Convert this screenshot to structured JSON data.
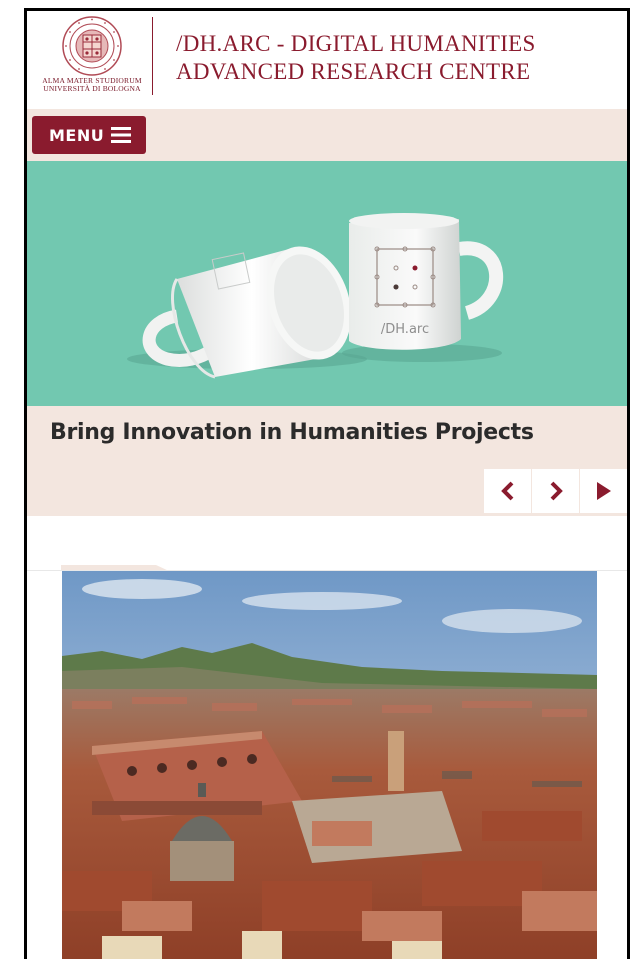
{
  "header": {
    "logo_lines": [
      "ALMA MATER STUDIORUM",
      "UNIVERSITÀ DI BOLOGNA"
    ],
    "title_line1": "/DH.ARC - DIGITAL HUMANITIES",
    "title_line2": "ADVANCED RESEARCH CENTRE"
  },
  "menu": {
    "label": "MENU",
    "icon": "hamburger-icon"
  },
  "slider": {
    "mug_label": "/DH.arc",
    "caption": "Bring Innovation in Humanities Projects",
    "controls": [
      "chevron-left-icon",
      "chevron-right-icon",
      "play-icon"
    ]
  },
  "colors": {
    "brand": "#8a1b2e",
    "beige": "#f3e6df",
    "teal": "#72c8b0"
  }
}
